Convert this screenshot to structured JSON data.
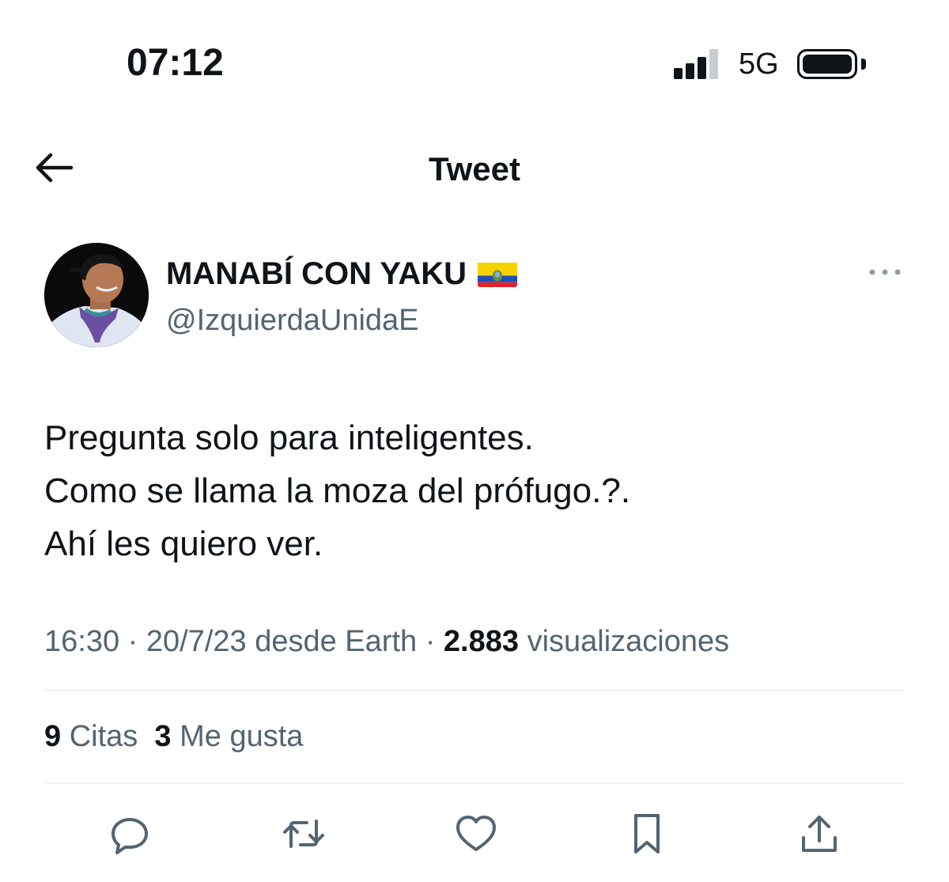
{
  "status_bar": {
    "time": "07:12",
    "network": "5G"
  },
  "header": {
    "title": "Tweet",
    "back_icon": "arrow-left-icon"
  },
  "author": {
    "name": "MANABÍ CON YAKU",
    "handle": "@IzquierdaUnidaE",
    "flag_icon": "ecuador-flag-icon"
  },
  "tweet": {
    "lines": [
      "Pregunta solo para inteligentes.",
      "Como se llama la moza del prófugo.?.",
      "Ahí les quiero ver."
    ]
  },
  "meta": {
    "time": "16:30",
    "separator": "·",
    "date_source": "20/7/23 desde Earth",
    "views_count": "2.883",
    "views_label": "visualizaciones"
  },
  "stats": {
    "quotes_count": "9",
    "quotes_label": "Citas",
    "likes_count": "3",
    "likes_label": "Me gusta"
  },
  "actions": [
    "reply-icon",
    "retweet-icon",
    "like-icon",
    "bookmark-icon",
    "share-icon"
  ],
  "colors": {
    "text": "#0f1419",
    "secondary": "#536471",
    "divider": "#eff3f4",
    "icon": "#536471"
  }
}
